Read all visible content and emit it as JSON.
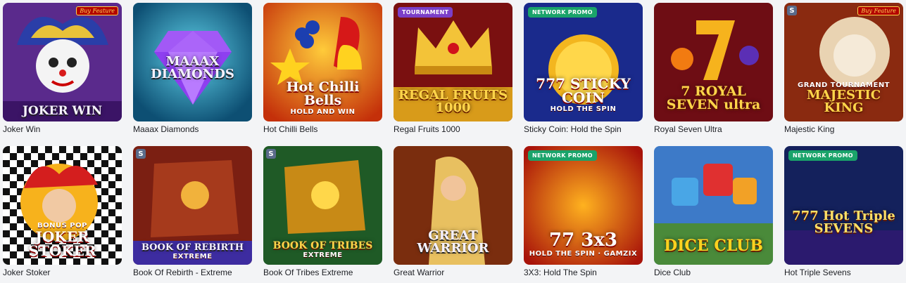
{
  "games": [
    {
      "title": "Joker Win",
      "logo": "JOKER WIN",
      "badge": "",
      "buy": "Buy Feature",
      "provider": ""
    },
    {
      "title": "Maaax Diamonds",
      "logo": "MAAAX DIAMONDS",
      "badge": "",
      "buy": "",
      "provider": ""
    },
    {
      "title": "Hot Chilli Bells",
      "logo": "Hot Chilli Bells",
      "sub": "HOLD AND WIN",
      "badge": "",
      "buy": "",
      "provider": ""
    },
    {
      "title": "Regal Fruits 1000",
      "logo": "REGAL FRUITS 1000",
      "badge": "TOURNAMENT",
      "buy": "",
      "provider": ""
    },
    {
      "title": "Sticky Coin: Hold the Spin",
      "logo": "777 STICKY COIN",
      "sub": "HOLD THE SPIN",
      "badge": "NETWORK PROMO",
      "buy": "",
      "provider": ""
    },
    {
      "title": "Royal Seven Ultra",
      "logo": "7 ROYAL SEVEN ultra",
      "badge": "",
      "buy": "",
      "provider": ""
    },
    {
      "title": "Majestic King",
      "logo": "MAJESTIC KING",
      "sub": "GRAND TOURNAMENT",
      "badge": "",
      "buy": "Buy Feature",
      "provider": "S"
    },
    {
      "title": "Joker Stoker",
      "logo": "JOKER STOKER",
      "sub": "BONUS POP",
      "badge": "",
      "buy": "",
      "provider": ""
    },
    {
      "title": "Book Of Rebirth - Extreme",
      "logo": "BOOK OF REBIRTH",
      "sub": "EXTREME",
      "badge": "",
      "buy": "",
      "provider": "S"
    },
    {
      "title": "Book Of Tribes Extreme",
      "logo": "BOOK OF TRIBES",
      "sub": "EXTREME",
      "badge": "",
      "buy": "",
      "provider": "S"
    },
    {
      "title": "Great Warrior",
      "logo": "GREAT WARRIOR",
      "badge": "",
      "buy": "",
      "provider": ""
    },
    {
      "title": "3X3: Hold The Spin",
      "logo": "77 3x3",
      "sub": "HOLD THE SPIN · GAMZIX",
      "badge": "NETWORK PROMO",
      "buy": "",
      "provider": ""
    },
    {
      "title": "Dice Club",
      "logo": "DICE CLUB",
      "badge": "",
      "buy": "",
      "provider": ""
    },
    {
      "title": "Hot Triple Sevens",
      "logo": "777 Hot Triple SEVENS",
      "badge": "NETWORK PROMO",
      "buy": "",
      "provider": ""
    }
  ],
  "colors": {
    "promo": "#1aa36a",
    "tournament": "#7b3fc8",
    "page_bg": "#f3f4f6",
    "title_text": "#1d1f24"
  }
}
